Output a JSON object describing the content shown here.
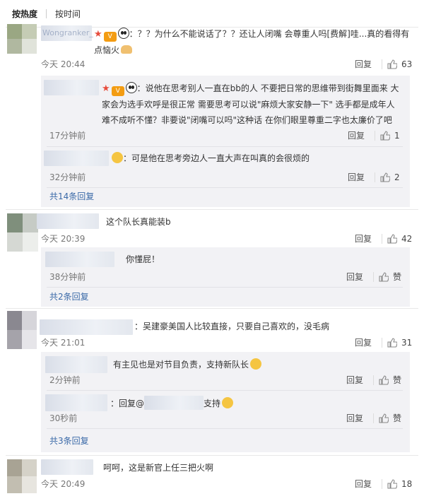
{
  "sort": {
    "hot": "按热度",
    "time": "按时间"
  },
  "colors": {
    "link": "#3b6aa8",
    "like_icon": "#888888",
    "star": "#e74c3c"
  },
  "icons": {
    "like": "thumbs-up-icon"
  },
  "comments": [
    {
      "username_partial": "Wongranker_",
      "text": "：？？为什么不能说话了？？还让人闭嘴 会尊重人吗[费解]哇...真的看得有点恼火",
      "time": "今天 20:44",
      "reply": "回复",
      "likes": "63",
      "subs": [
        {
          "text": "：说他在思考别人一直在bb的人 不要把日常的思维带到街舞里面来 大家会为选手欢呼是很正常 需要思考可以说\"麻烦大家安静一下\" 选手都是成年人 难不成听不懂？非要说\"闭嘴可以吗\"这种话 在你们眼里尊重二字也太廉价了吧",
          "time": "17分钟前",
          "reply": "回复",
          "likes": "1"
        },
        {
          "text": "：可是他在思考旁边人一直大声在叫真的会很烦的",
          "time": "32分钟前",
          "reply": "回复",
          "likes": "2"
        }
      ],
      "more": "共14条回复"
    },
    {
      "text": "这个队长真能装b",
      "time": "今天 20:39",
      "reply": "回复",
      "likes": "42",
      "subs": [
        {
          "text": "你懂屁！",
          "time": "38分钟前",
          "reply": "回复",
          "likes": "赞"
        }
      ],
      "more": "共2条回复"
    },
    {
      "text": "：吴建豪美国人比较直接，只要自己喜欢的，没毛病",
      "time": "今天 21:01",
      "reply": "回复",
      "likes": "31",
      "subs": [
        {
          "text": "有主见也是对节目负责，支持新队长",
          "time": "2分钟前",
          "reply": "回复",
          "likes": "赞"
        },
        {
          "text_prefix": "：回复@",
          "text_suffix": "支持",
          "time": "30秒前",
          "reply": "回复",
          "likes": "赞"
        }
      ],
      "more": "共3条回复"
    },
    {
      "text": "呵呵，这是新官上任三把火啊",
      "time": "今天 20:49",
      "reply": "回复",
      "likes": "18"
    }
  ]
}
